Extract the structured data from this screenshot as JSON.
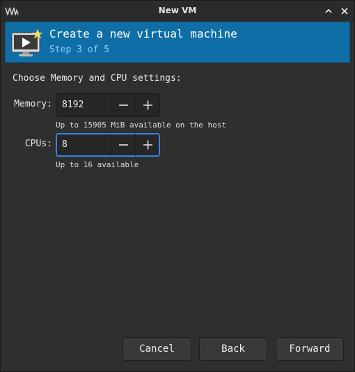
{
  "window": {
    "title": "New VM"
  },
  "banner": {
    "title": "Create a new virtual machine",
    "step": "Step 3 of 5"
  },
  "section": {
    "label": "Choose Memory and CPU settings:"
  },
  "memory": {
    "label": "Memory:",
    "value": "8192",
    "hint": "Up to 15905 MiB available on the host"
  },
  "cpus": {
    "label": "CPUs:",
    "value": "8",
    "hint": "Up to 16 available"
  },
  "buttons": {
    "cancel": "Cancel",
    "back": "Back",
    "forward": "Forward"
  },
  "colors": {
    "banner": "#0e6ea5",
    "step_text": "#8fd3ff",
    "focus": "#3584e4"
  },
  "icons": {
    "minimize": "chevron-up-icon",
    "close": "close-icon",
    "decrement": "minus-icon",
    "increment": "plus-icon",
    "banner": "monitor-play-icon"
  }
}
